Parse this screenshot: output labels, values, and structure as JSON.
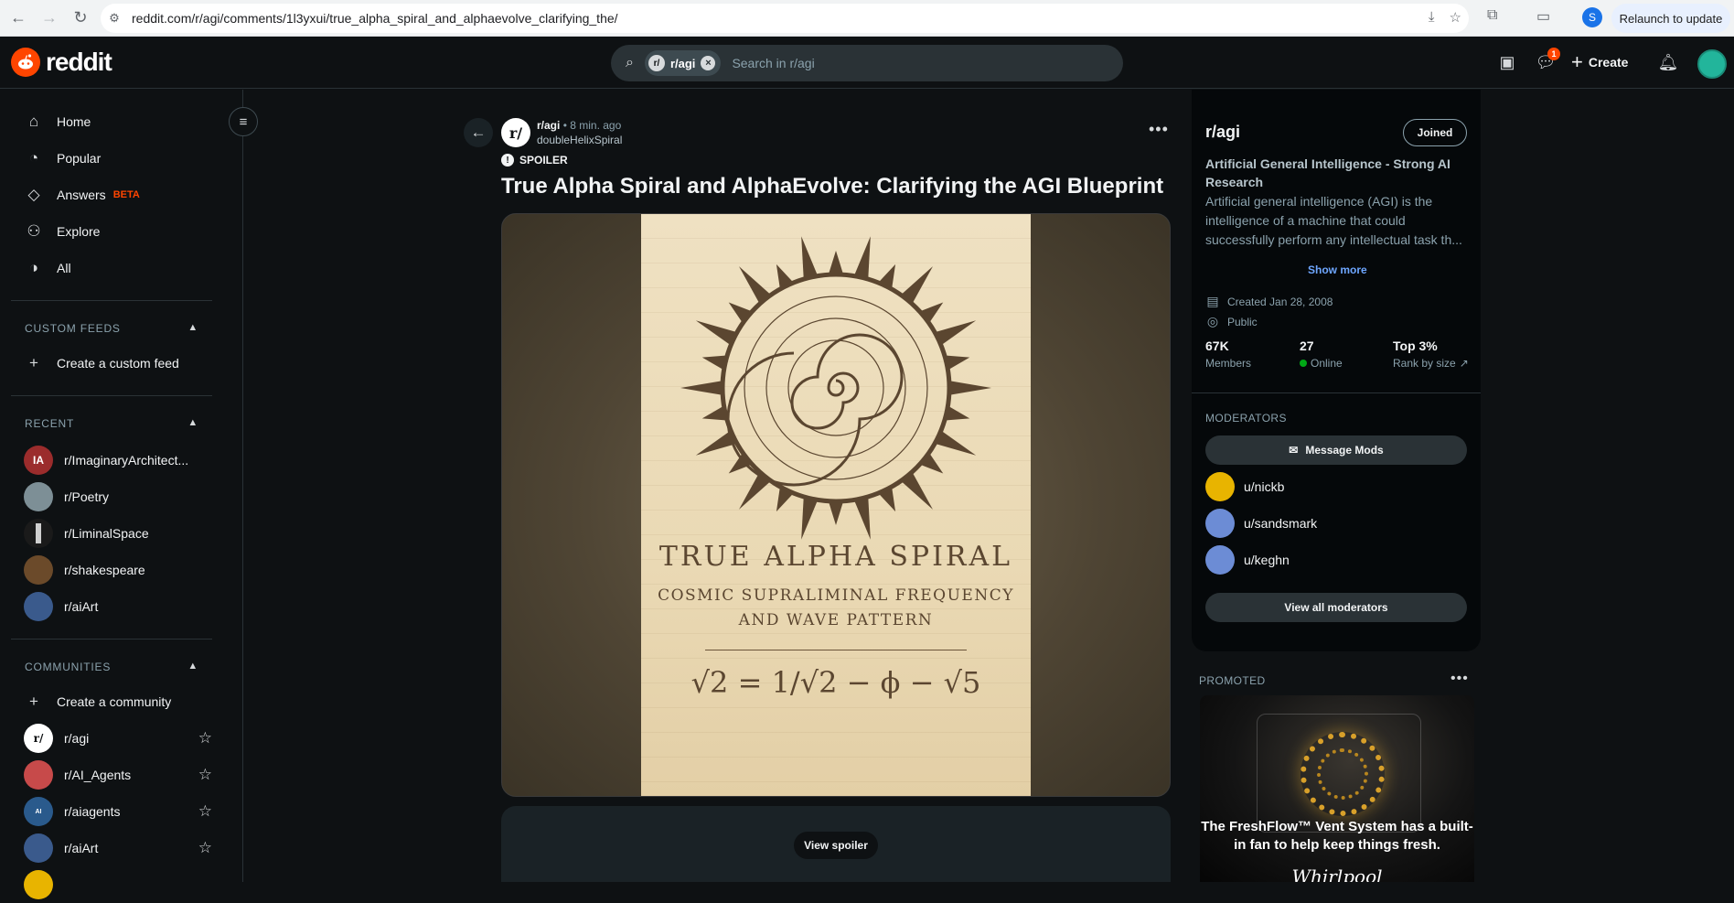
{
  "browser": {
    "url": "reddit.com/r/agi/comments/1l3yxui/true_alpha_spiral_and_alphaevolve_clarifying_the/",
    "profile_initial": "S",
    "relaunch_label": "Relaunch to update"
  },
  "header": {
    "logo_text": "reddit",
    "search_chip": "r/agi",
    "search_placeholder": "Search in r/agi",
    "chat_badge": "1",
    "create_label": "Create"
  },
  "sidebar": {
    "nav": [
      {
        "label": "Home",
        "icon": "home-icon"
      },
      {
        "label": "Popular",
        "icon": "popular-icon"
      },
      {
        "label": "Answers",
        "icon": "answers-icon",
        "badge": "BETA"
      },
      {
        "label": "Explore",
        "icon": "explore-icon"
      },
      {
        "label": "All",
        "icon": "all-icon"
      }
    ],
    "custom_feeds_header": "CUSTOM FEEDS",
    "create_custom_feed": "Create a custom feed",
    "recent_header": "RECENT",
    "recent": [
      {
        "label": "r/ImaginaryArchitect...",
        "color": "#9b2c2c"
      },
      {
        "label": "r/Poetry",
        "color": "#7d8f96"
      },
      {
        "label": "r/LiminalSpace",
        "color": "#cfcfcf"
      },
      {
        "label": "r/shakespeare",
        "color": "#6b4a2a"
      },
      {
        "label": "r/aiArt",
        "color": "#3a5a8c"
      }
    ],
    "communities_header": "COMMUNITIES",
    "create_community": "Create a community",
    "communities": [
      {
        "label": "r/agi",
        "color": "#ffffff"
      },
      {
        "label": "r/AI_Agents",
        "color": "#c74a4a"
      },
      {
        "label": "r/aiagents",
        "color": "#2a5a8c"
      },
      {
        "label": "r/aiArt",
        "color": "#3a5a8c"
      }
    ]
  },
  "post": {
    "subreddit": "r/agi",
    "time": "• 8 min. ago",
    "author": "doubleHelixSpiral",
    "flair": "SPOILER",
    "title": "True Alpha Spiral and AlphaEvolve: Clarifying the AGI Blueprint",
    "image": {
      "title": "TRUE ALPHA SPIRAL",
      "subtitle_1": "COSMIC SUPRALIMINAL FREQUENCY",
      "subtitle_2": "AND WAVE PATTERN",
      "equation": "√2 = 1/√2 − ϕ − √5"
    },
    "view_spoiler": "View spoiler"
  },
  "community": {
    "name": "r/agi",
    "joined_label": "Joined",
    "title": "Artificial General Intelligence - Strong AI Research",
    "description": "Artificial general intelligence (AGI) is the intelligence of a machine that could successfully perform any intellectual task th...",
    "show_more": "Show more",
    "created": "Created Jan 28, 2008",
    "visibility": "Public",
    "members_value": "67K",
    "members_label": "Members",
    "online_value": "27",
    "online_label": "Online",
    "rank_value": "Top 3%",
    "rank_label": "Rank by size",
    "moderators_header": "MODERATORS",
    "message_mods": "Message Mods",
    "moderators": [
      {
        "name": "u/nickb",
        "color": "#e8b400"
      },
      {
        "name": "u/sandsmark",
        "color": "#6c8cd5"
      },
      {
        "name": "u/keghn",
        "color": "#6c8cd5"
      }
    ],
    "view_all_moderators": "View all moderators"
  },
  "promoted": {
    "label": "PROMOTED",
    "ad_text": "The FreshFlow™ Vent System has a built-in fan to help keep things fresh.",
    "brand": "Whirlpool"
  }
}
